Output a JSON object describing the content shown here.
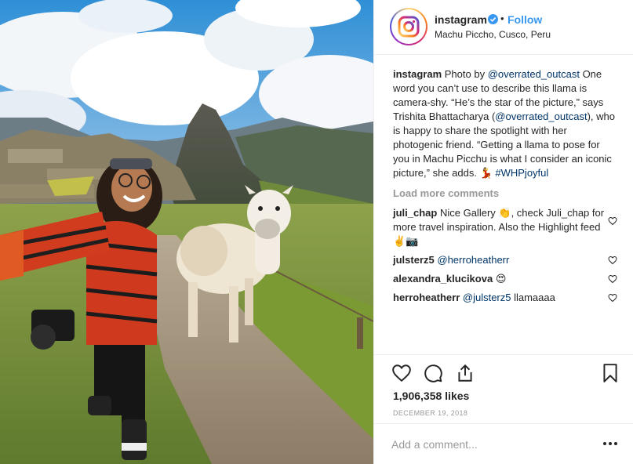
{
  "post": {
    "username": "instagram",
    "follow_label": "Follow",
    "separator": "•",
    "location": "Machu Piccho, Cusco, Peru"
  },
  "caption": {
    "username": "instagram",
    "text_1": " Photo by ",
    "mention_1": "@overrated_outcast",
    "text_2": " One word you can’t use to describe this llama is camera-shy. “He’s the star of the picture,” says Trishita Bhattacharya (",
    "mention_2": "@overrated_outcast",
    "text_3": "), who is happy to share the spotlight with her photogenic friend. “Getting a llama to pose for you in Machu Picchu is what I consider an iconic picture,” she adds. ",
    "emoji": "💃",
    "hashtag": "#WHPjoyful"
  },
  "load_more": "Load more comments",
  "comments": [
    {
      "user": "juli_chap",
      "text_1": " Nice Gallery 👏, check Juli_chap for more travel inspiration. Also the Highlight feed ",
      "emoji": "✌️📷"
    },
    {
      "user": "julsterz5",
      "mention": "@herroheatherr"
    },
    {
      "user": "alexandra_klucikova",
      "emoji": "😍"
    },
    {
      "user": "herroheatherr",
      "mention": "@julsterz5",
      "text": " llamaaaa"
    }
  ],
  "likes": "1,906,358 likes",
  "date": "December 19, 2018",
  "add_comment": {
    "placeholder": "Add a comment..."
  },
  "icons": {
    "like": "heart-icon",
    "comment": "comment-icon",
    "share": "share-icon",
    "save": "bookmark-icon",
    "more": "more-options-icon",
    "verified": "verified-badge-icon"
  },
  "colors": {
    "link": "#003569",
    "follow": "#3897f0",
    "muted": "#999999",
    "verified": "#3897f0"
  }
}
